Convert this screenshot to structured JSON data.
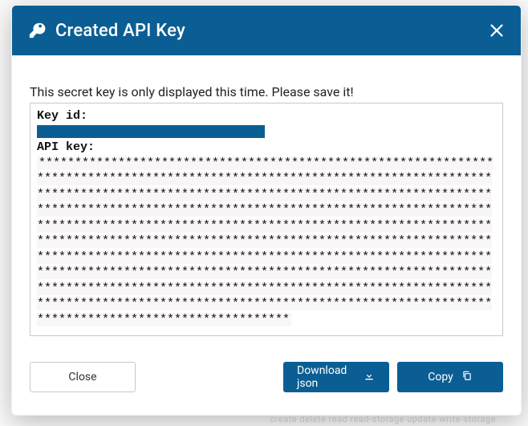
{
  "colors": {
    "primary": "#0b5e94"
  },
  "modal": {
    "title": "Created API Key",
    "icon": "key-icon",
    "close_icon": "close-icon"
  },
  "body": {
    "warning": "This secret key is only displayed this time. Please save it!",
    "keyid_label": "Key id:",
    "keyid_value_redacted": true,
    "apikey_label": "API key:",
    "apikey_value": "*****************************************************************************************************************************************************************************************************************************************************************************************************************************************************************************************************************************************************************************************************************************************************************************************************************************************************************************************"
  },
  "footer": {
    "close_label": "Close",
    "download_label": "Download json",
    "download_icon": "download-icon",
    "copy_label": "Copy",
    "copy_icon": "copy-icon"
  },
  "background": {
    "hint_right": "create delete read read-storage update write-storage",
    "hint_left": ""
  }
}
